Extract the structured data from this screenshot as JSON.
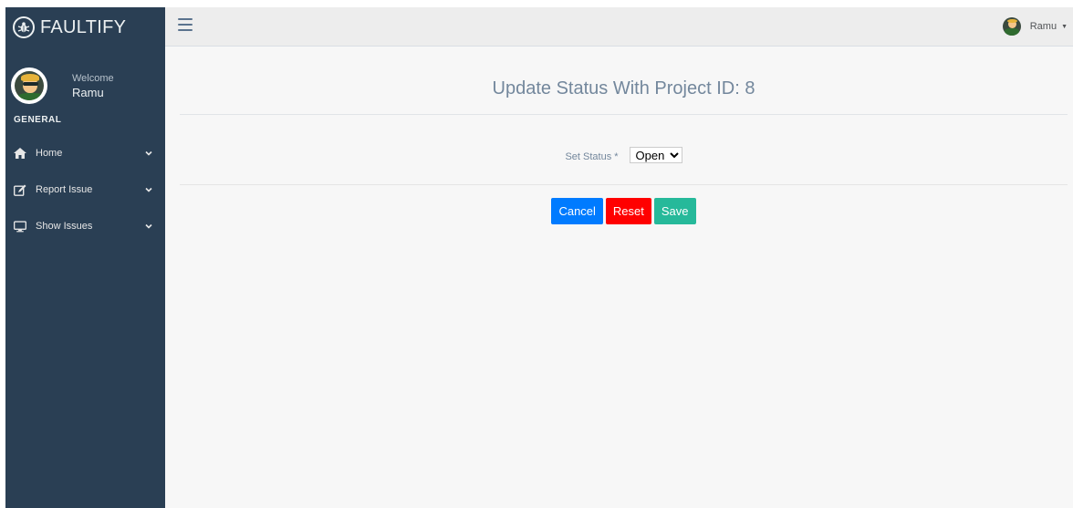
{
  "brand": {
    "name": "FAULTIFY",
    "icon": "bug-icon"
  },
  "profile": {
    "welcome": "Welcome",
    "username": "Ramu"
  },
  "sidebar": {
    "section": "GENERAL",
    "items": [
      {
        "label": "Home",
        "icon": "home-icon"
      },
      {
        "label": "Report Issue",
        "icon": "edit-icon"
      },
      {
        "label": "Show Issues",
        "icon": "desktop-icon"
      }
    ]
  },
  "topnav": {
    "username": "Ramu",
    "caret": "▼"
  },
  "main": {
    "title": "Update Status With Project ID: 8",
    "status_label": "Set Status",
    "required_mark": "*",
    "status_value": "Open",
    "buttons": {
      "cancel": "Cancel",
      "reset": "Reset",
      "save": "Save"
    }
  },
  "colors": {
    "sidebar_bg": "#2a3f54",
    "cancel": "#007bff",
    "reset": "#ff0000",
    "save": "#26b99a",
    "title": "#73879c"
  }
}
